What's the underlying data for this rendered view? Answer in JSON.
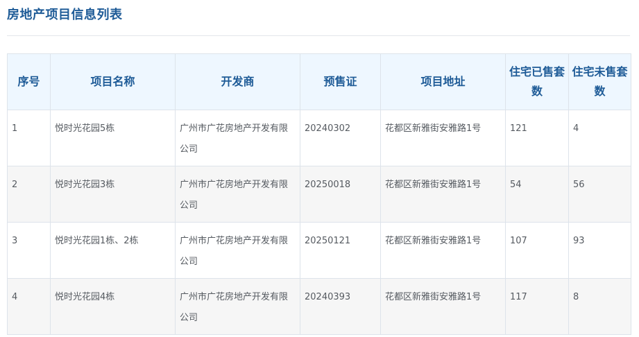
{
  "page": {
    "title": "房地产项目信息列表"
  },
  "table": {
    "headers": {
      "index": "序号",
      "name": "项目名称",
      "developer": "开发商",
      "presale": "预售证",
      "address": "项目地址",
      "sold": "住宅已售套数",
      "unsold": "住宅未售套数"
    },
    "rows": [
      {
        "index": "1",
        "name": "悦时光花园5栋",
        "developer": "广州市广花房地产开发有限公司",
        "presale": "20240302",
        "address": "花都区新雅街安雅路1号",
        "sold": "121",
        "unsold": "4"
      },
      {
        "index": "2",
        "name": "悦时光花园3栋",
        "developer": "广州市广花房地产开发有限公司",
        "presale": "20250018",
        "address": "花都区新雅街安雅路1号",
        "sold": "54",
        "unsold": "56"
      },
      {
        "index": "3",
        "name": "悦时光花园1栋、2栋",
        "developer": "广州市广花房地产开发有限公司",
        "presale": "20250121",
        "address": "花都区新雅街安雅路1号",
        "sold": "107",
        "unsold": "93"
      },
      {
        "index": "4",
        "name": "悦时光花园4栋",
        "developer": "广州市广花房地产开发有限公司",
        "presale": "20240393",
        "address": "花都区新雅街安雅路1号",
        "sold": "117",
        "unsold": "8"
      }
    ]
  },
  "colors": {
    "title": "#1e5b97",
    "header_bg": "#eef7ff",
    "header_text": "#1e5b97",
    "row_alt_bg": "#f6f6f6",
    "border": "#dde3ea",
    "cell_text": "#555a60"
  }
}
